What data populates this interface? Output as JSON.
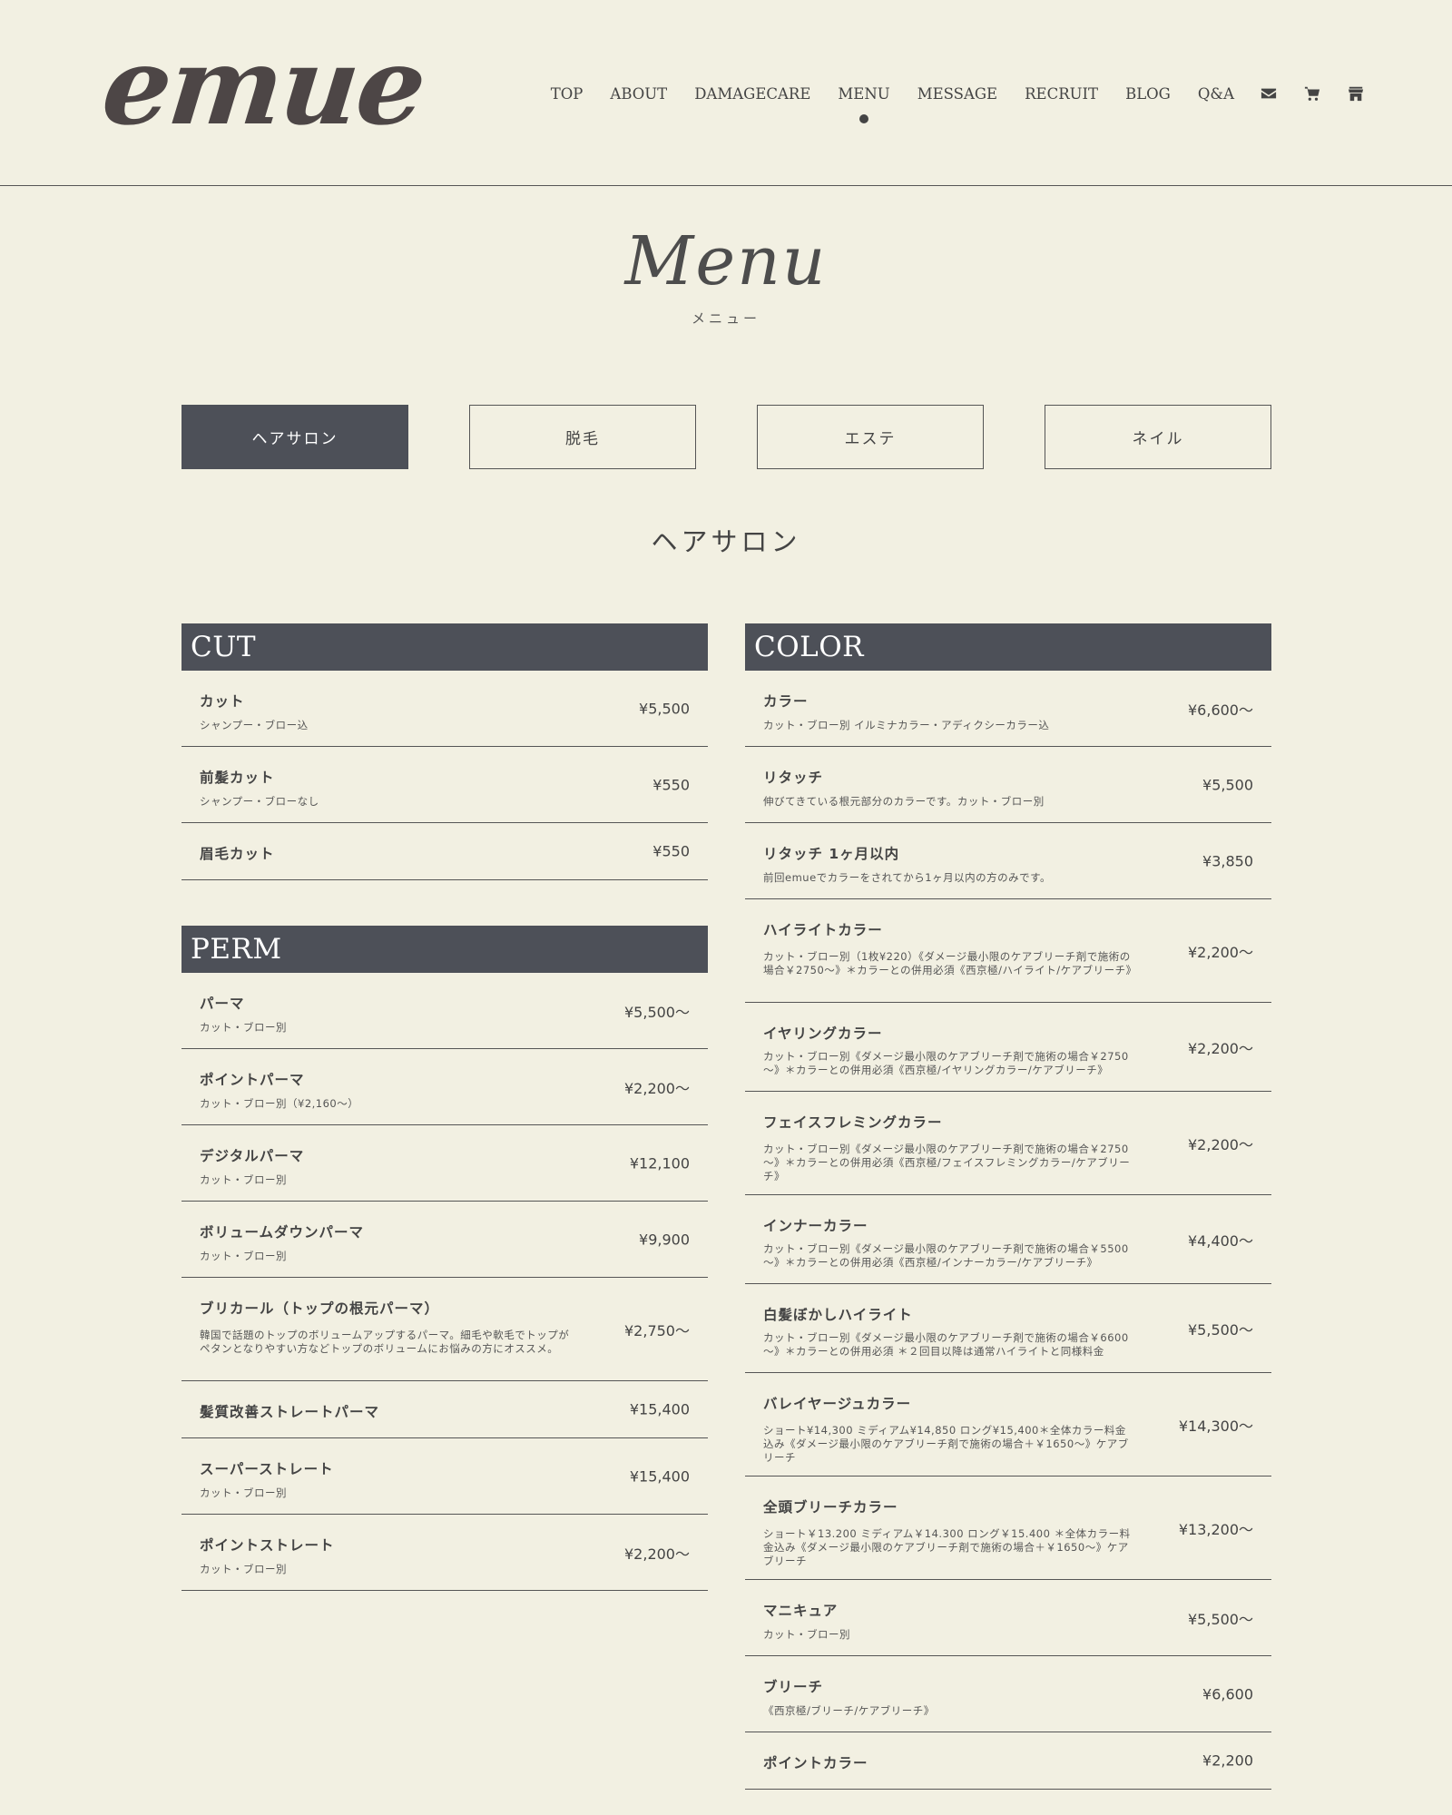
{
  "brand": {
    "logo_text": "emue"
  },
  "nav": {
    "items": [
      "TOP",
      "ABOUT",
      "DAMAGECARE",
      "MENU",
      "MESSAGE",
      "RECRUIT",
      "BLOG",
      "Q&A"
    ],
    "icons": [
      "envelope-icon",
      "cart-icon",
      "store-icon"
    ]
  },
  "heading": {
    "title": "Menu",
    "subtitle": "メニュー"
  },
  "tabs": [
    "ヘアサロン",
    "脱毛",
    "エステ",
    "ネイル"
  ],
  "section_title": "ヘアサロン",
  "cut": {
    "title": "CUT",
    "items": [
      {
        "name": "カット",
        "desc": "シャンプー・ブロー込",
        "price": "¥5,500"
      },
      {
        "name": "前髪カット",
        "desc": "シャンプー・ブローなし",
        "price": "¥550"
      },
      {
        "name": "眉毛カット",
        "price": "¥550"
      }
    ]
  },
  "perm": {
    "title": "PERM",
    "items": [
      {
        "name": "パーマ",
        "desc": "カット・ブロー別",
        "price": "¥5,500～"
      },
      {
        "name": "ポイントパーマ",
        "desc": "カット・ブロー別（¥2,160～）",
        "price": "¥2,200～"
      },
      {
        "name": "デジタルパーマ",
        "desc": "カット・ブロー別",
        "price": "¥12,100"
      },
      {
        "name": "ボリュームダウンパーマ",
        "desc": "カット・ブロー別",
        "price": "¥9,900"
      },
      {
        "name": "ブリカール（トップの根元パーマ）",
        "desc": "韓国で話題のトップのボリュームアップするパーマ。細毛や軟毛でトップがペタンとなりやすい方などトップのボリュームにお悩みの方にオススメ。",
        "price": "¥2,750～"
      },
      {
        "name": "髪質改善ストレートパーマ",
        "price": "¥15,400"
      },
      {
        "name": "スーパーストレート",
        "desc": "カット・ブロー別",
        "price": "¥15,400"
      },
      {
        "name": "ポイントストレート",
        "desc": "カット・ブロー別",
        "price": "¥2,200～"
      }
    ]
  },
  "color": {
    "title": "COLOR",
    "items": [
      {
        "name": "カラー",
        "desc": "カット・ブロー別 イルミナカラー・アディクシーカラー込",
        "price": "¥6,600～"
      },
      {
        "name": "リタッチ",
        "desc": "伸びてきている根元部分のカラーです。カット・ブロー別",
        "price": "¥5,500"
      },
      {
        "name": "リタッチ 1ヶ月以内",
        "desc": "前回emueでカラーをされてから1ヶ月以内の方のみです。",
        "price": "¥3,850"
      },
      {
        "name": "ハイライトカラー",
        "desc": "カット・ブロー別（1枚¥220）《ダメージ最小限のケアブリーチ剤で施術の場合￥2750～》＊カラーとの併用必須《西京極/ハイライト/ケアブリーチ》",
        "price": "¥2,200～"
      },
      {
        "name": "イヤリングカラー",
        "desc": "カット・ブロー別《ダメージ最小限のケアブリーチ剤で施術の場合￥2750～》＊カラーとの併用必須《西京極/イヤリングカラー/ケアブリーチ》",
        "price": "¥2,200～"
      },
      {
        "name": "フェイスフレミングカラー",
        "desc": "カット・ブロー別《ダメージ最小限のケアブリーチ剤で施術の場合￥2750～》＊カラーとの併用必須《西京極/フェイスフレミングカラー/ケアブリーチ》",
        "price": "¥2,200～"
      },
      {
        "name": "インナーカラー",
        "desc": "カット・ブロー別《ダメージ最小限のケアブリーチ剤で施術の場合￥5500～》＊カラーとの併用必須《西京極/インナーカラー/ケアブリーチ》",
        "price": "¥4,400～"
      },
      {
        "name": "白髪ぼかしハイライト",
        "desc": "カット・ブロー別《ダメージ最小限のケアブリーチ剤で施術の場合￥6600～》＊カラーとの併用必須 ＊２回目以降は通常ハイライトと同様料金",
        "price": "¥5,500～"
      },
      {
        "name": "バレイヤージュカラー",
        "desc": "ショート¥14,300 ミディアム¥14,850 ロング¥15,400＊全体カラー料金込み《ダメージ最小限のケアブリーチ剤で施術の場合＋￥1650～》ケアブリーチ",
        "price": "¥14,300～"
      },
      {
        "name": "全頭ブリーチカラー",
        "desc": "ショート￥13.200 ミディアム￥14.300 ロング￥15.400 ＊全体カラー料金込み《ダメージ最小限のケアブリーチ剤で施術の場合＋￥1650～》ケアブリーチ",
        "price": "¥13,200～"
      },
      {
        "name": "マニキュア",
        "desc": "カット・ブロー別",
        "price": "¥5,500～"
      },
      {
        "name": "ブリーチ",
        "desc": "《西京極/ブリーチ/ケアブリーチ》",
        "price": "¥6,600"
      },
      {
        "name": "ポイントカラー",
        "price": "¥2,200"
      }
    ]
  }
}
